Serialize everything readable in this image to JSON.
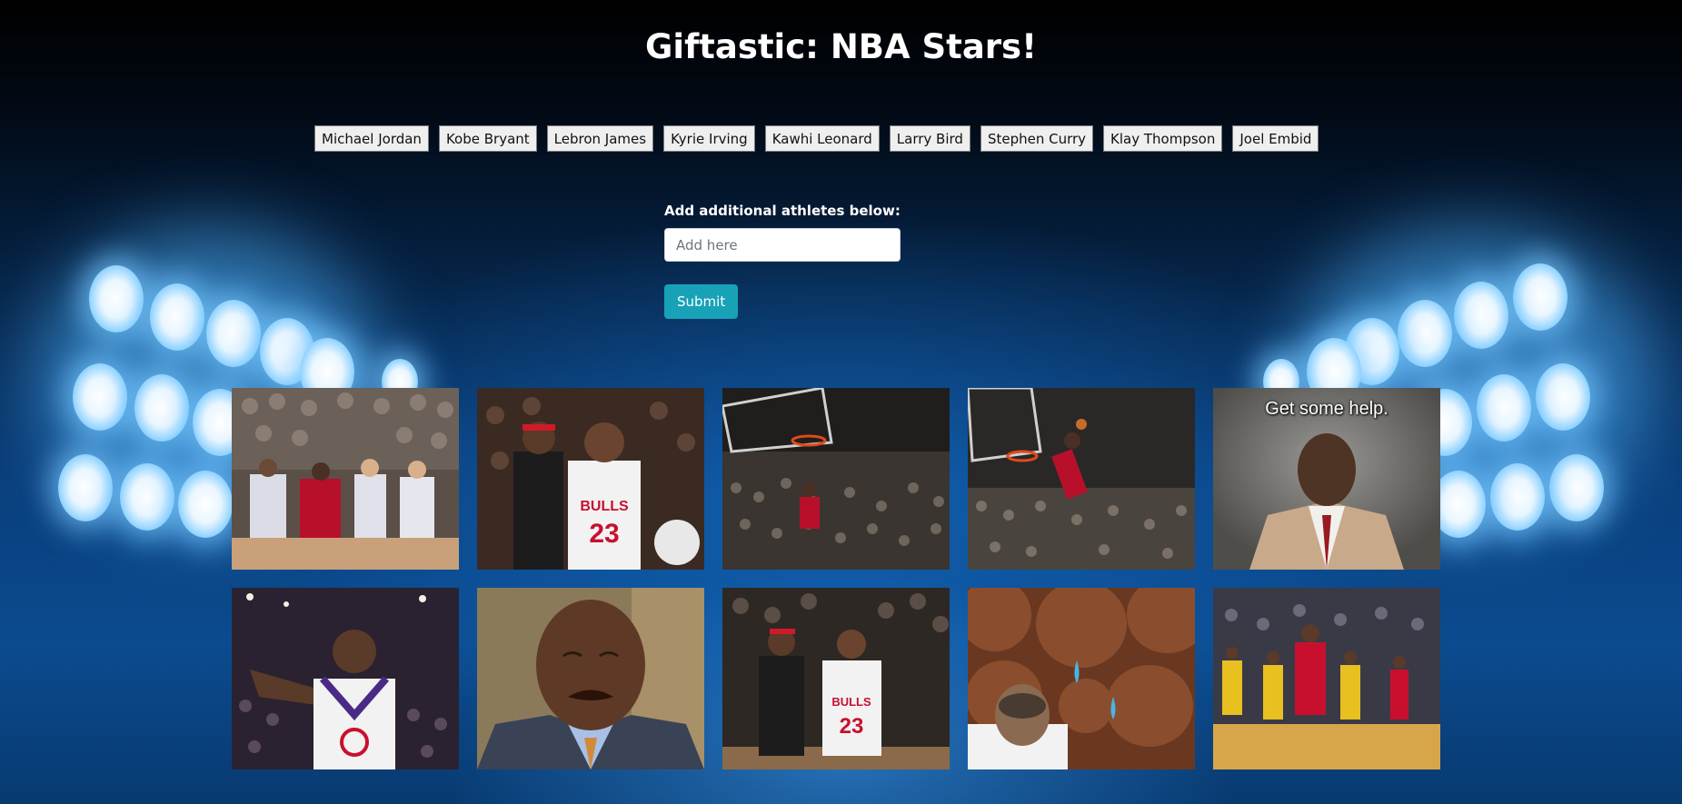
{
  "page": {
    "title": "Giftastic: NBA Stars!"
  },
  "athletes": [
    "Michael Jordan",
    "Kobe Bryant",
    "Lebron James",
    "Kyrie Irving",
    "Kawhi Leonard",
    "Larry Bird",
    "Stephen Curry",
    "Klay Thompson",
    "Joel Embid"
  ],
  "form": {
    "label": "Add additional athletes below:",
    "placeholder": "Add here",
    "submit_label": "Submit"
  },
  "gifs": [
    {
      "name": "gif-1",
      "caption": ""
    },
    {
      "name": "gif-2",
      "caption": ""
    },
    {
      "name": "gif-3",
      "caption": ""
    },
    {
      "name": "gif-4",
      "caption": ""
    },
    {
      "name": "gif-5",
      "caption": "Get some help."
    },
    {
      "name": "gif-6",
      "caption": ""
    },
    {
      "name": "gif-7",
      "caption": ""
    },
    {
      "name": "gif-8",
      "caption": ""
    },
    {
      "name": "gif-9",
      "caption": ""
    },
    {
      "name": "gif-10",
      "caption": ""
    }
  ],
  "colors": {
    "submit": "#17a2b8",
    "background_top": "#000000",
    "background_bottom": "#0b4b8f"
  }
}
